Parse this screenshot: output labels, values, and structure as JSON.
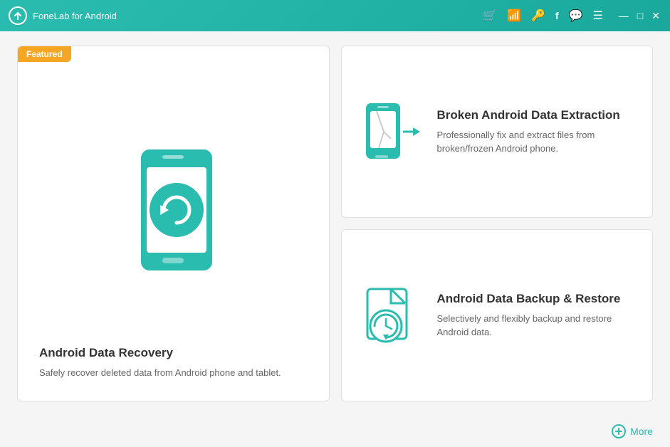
{
  "titleBar": {
    "appName": "FoneLab for Android",
    "icons": [
      "cart",
      "wifi",
      "key",
      "facebook",
      "chat",
      "menu"
    ],
    "windowControls": [
      "minimize",
      "maximize",
      "close"
    ]
  },
  "cards": {
    "featured": {
      "badge": "Featured",
      "title": "Android Data Recovery",
      "description": "Safely recover deleted data from Android phone and tablet."
    },
    "brokenExtraction": {
      "title": "Broken Android Data Extraction",
      "description": "Professionally fix and extract files from broken/frozen Android phone."
    },
    "backup": {
      "title": "Android Data Backup & Restore",
      "description": "Selectively and flexibly backup and restore Android data."
    }
  },
  "bottomBar": {
    "moreLabel": "More"
  }
}
